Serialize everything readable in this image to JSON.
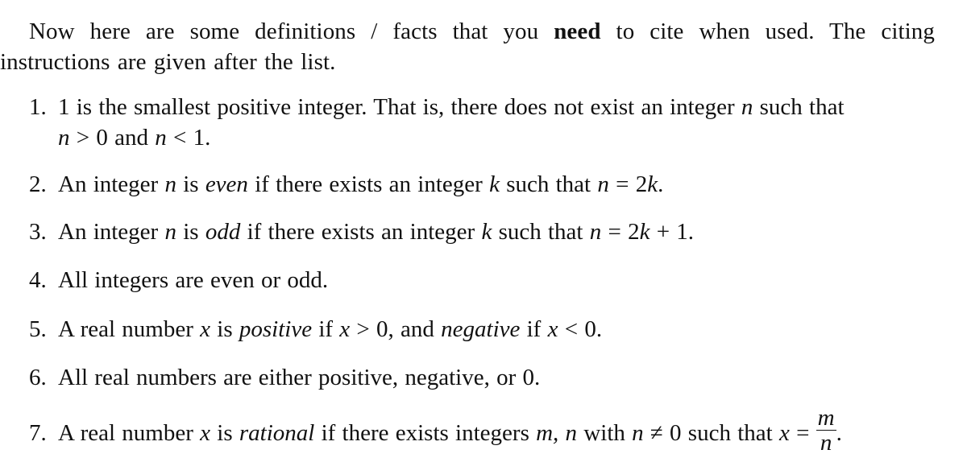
{
  "intro": {
    "part1": "Now here are some definitions / facts that you ",
    "bold": "need",
    "part2": " to cite when used.  The citing instructions are given after the list."
  },
  "items": [
    {
      "num": "1.",
      "line1": "1 is the smallest positive integer. That is, there does not exist an integer ",
      "var_n": "n",
      "line1_end": " such that",
      "line2_a": "n",
      "line2_b": " > 0 and ",
      "line2_c": "n",
      "line2_d": " < 1."
    },
    {
      "num": "2.",
      "a": "An integer ",
      "var_n": "n",
      "b": " is ",
      "term": "even",
      "c": " if there exists an integer ",
      "var_k": "k",
      "d": " such that ",
      "var_n2": "n",
      "e": " = 2",
      "var_k2": "k",
      "f": "."
    },
    {
      "num": "3.",
      "a": "An integer ",
      "var_n": "n",
      "b": " is ",
      "term": "odd",
      "c": " if there exists an integer ",
      "var_k": "k",
      "d": " such that ",
      "var_n2": "n",
      "e": " = 2",
      "var_k2": "k",
      "f": " + 1."
    },
    {
      "num": "4.",
      "text": "All integers are even or odd."
    },
    {
      "num": "5.",
      "a": "A real number ",
      "var_x": "x",
      "b": " is ",
      "term1": "positive",
      "c": " if ",
      "var_x2": "x",
      "d": " > 0, and ",
      "term2": "negative",
      "e": " if ",
      "var_x3": "x",
      "f": " < 0."
    },
    {
      "num": "6.",
      "text": "All real numbers are either positive, negative, or 0."
    },
    {
      "num": "7.",
      "a": "A real number ",
      "var_x": "x",
      "b": " is ",
      "term": "rational",
      "c": " if there exists integers ",
      "vars": "m, n",
      "d": " with ",
      "var_n": "n",
      "e": " ≠ 0 such that ",
      "var_x2": "x",
      "f": " = ",
      "frac_num": "m",
      "frac_den": "n",
      "g": "."
    }
  ]
}
